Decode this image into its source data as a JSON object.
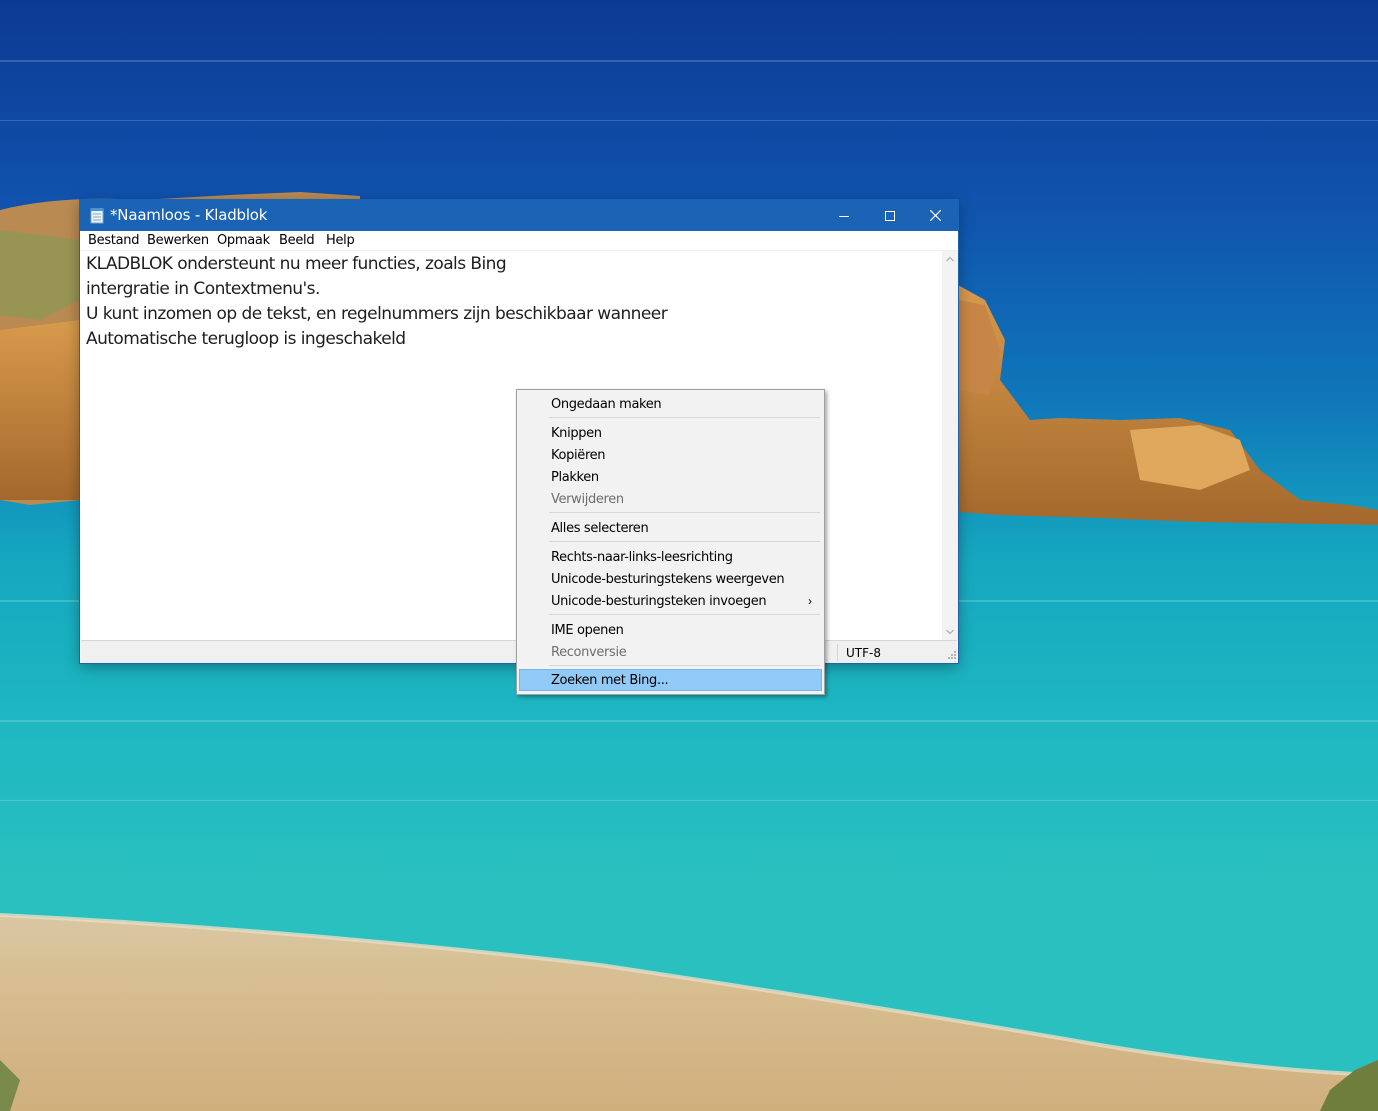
{
  "window": {
    "title": "*Naamloos - Kladblok",
    "menu": [
      "Bestand",
      "Bewerken",
      "Opmaak",
      "Beeld",
      "Help"
    ],
    "titlebar_color": "#1a63b5"
  },
  "editor": {
    "lines": [
      "KLADBLOK ondersteunt nu meer functies, zoals Bing",
      "intergratie in Contextmenu's.",
      "U kunt inzomen op de tekst, en regelnummers zijn beschikbaar wanneer",
      "Automatische terugloop is ingeschakeld"
    ]
  },
  "statusbar": {
    "encoding": "UTF-8"
  },
  "context_menu": {
    "items": [
      {
        "label": "Ongedaan maken",
        "enabled": true
      },
      {
        "label": "Knippen",
        "enabled": true
      },
      {
        "label": "Kopiëren",
        "enabled": true
      },
      {
        "label": "Plakken",
        "enabled": true
      },
      {
        "label": "Verwijderen",
        "enabled": false
      },
      {
        "label": "Alles selecteren",
        "enabled": true
      },
      {
        "label": "Rechts-naar-links-leesrichting",
        "enabled": true
      },
      {
        "label": "Unicode-besturingstekens weergeven",
        "enabled": true
      },
      {
        "label": "Unicode-besturingsteken invoegen",
        "enabled": true,
        "submenu": true,
        "submenu_glyph": "›"
      },
      {
        "label": "IME openen",
        "enabled": true
      },
      {
        "label": "Reconversie",
        "enabled": false
      },
      {
        "label": "Zoeken met Bing...",
        "enabled": true,
        "highlighted": true
      }
    ],
    "highlight_color": "#91c9f7"
  },
  "icons": {
    "app": "notepad-icon",
    "minimize": "minimize-icon",
    "maximize": "maximize-icon",
    "close": "close-icon"
  }
}
